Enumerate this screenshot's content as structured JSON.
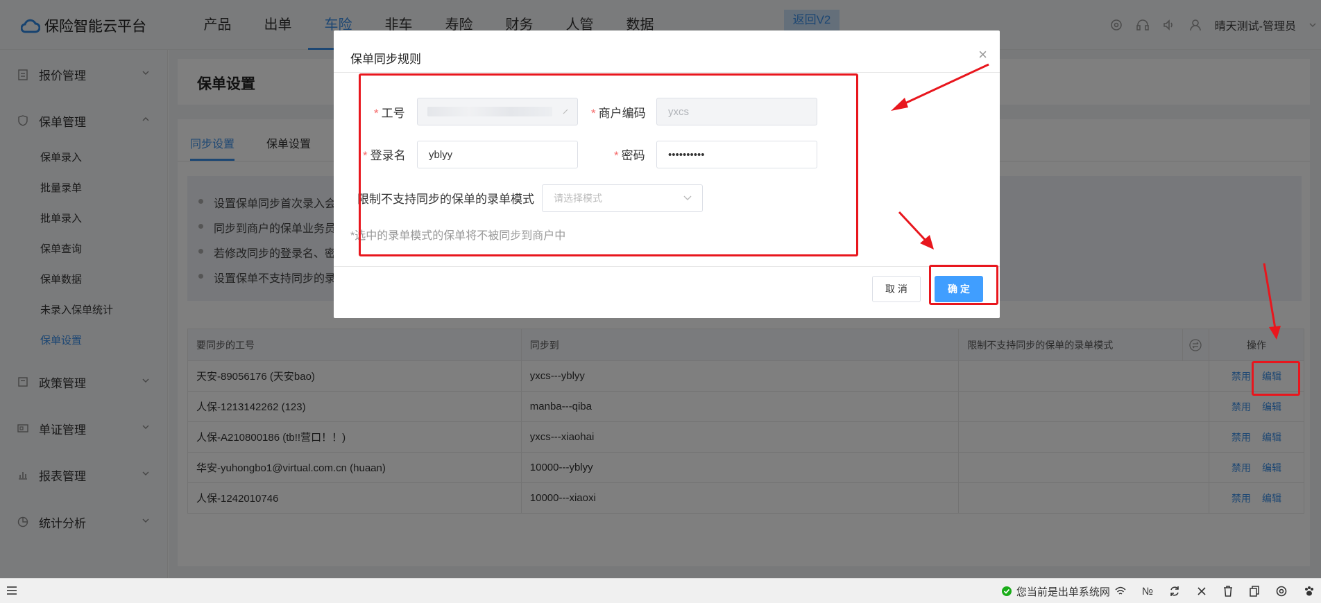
{
  "app": {
    "title": "保险智能云平台"
  },
  "topnav": {
    "items": [
      "产品",
      "出单",
      "车险",
      "非车",
      "寿险",
      "财务",
      "人管",
      "数据"
    ],
    "active_index": 2,
    "back_v2": "返回V2",
    "user": "晴天测试-管理员"
  },
  "sidebar": {
    "groups": {
      "quote": "报价管理",
      "policy": "保单管理",
      "rule": "政策管理",
      "voucher": "单证管理",
      "report": "报表管理",
      "stats": "统计分析"
    },
    "policy_items": [
      "保单录入",
      "批量录单",
      "批单录入",
      "保单查询",
      "保单数据",
      "未录入保单统计",
      "保单设置"
    ],
    "active_item": "保单设置"
  },
  "page": {
    "title": "保单设置",
    "tabs": [
      "同步设置",
      "保单设置"
    ],
    "tips": [
      "设置保单同步首次录入会",
      "同步到商户的保单业务员",
      "若修改同步的登录名、密",
      "设置保单不支持同步的录"
    ]
  },
  "table": {
    "headers": [
      "要同步的工号",
      "同步到",
      "限制不支持同步的保单的录单模式",
      "",
      "操作"
    ],
    "rows": [
      {
        "account": "天安-89056176 (天安bao)",
        "target": "yxcs---yblyy",
        "mode": ""
      },
      {
        "account": "人保-1213142262 (123)",
        "target": "manba---qiba",
        "mode": ""
      },
      {
        "account": "人保-A210800186 (tb!!营口！！)",
        "target": "yxcs---xiaohai",
        "mode": ""
      },
      {
        "account": "华安-yuhongbo1@virtual.com.cn (huaan)",
        "target": "10000---yblyy",
        "mode": ""
      },
      {
        "account": "人保-1242010746",
        "target": "10000---xiaoxi",
        "mode": ""
      }
    ],
    "op_disable": "禁用",
    "op_edit": "编辑"
  },
  "dialog": {
    "title": "保单同步规则",
    "close": "×",
    "fields": {
      "account_label": "工号",
      "merchant_label": "商户编码",
      "merchant_value": "yxcs",
      "login_label": "登录名",
      "login_value": "yblyy",
      "password_label": "密码",
      "password_value": "••••••••••",
      "mode_label": "限制不支持同步的保单的录单模式",
      "mode_placeholder": "请选择模式"
    },
    "required_mark": "*",
    "hint": "*选中的录单模式的保单将不被同步到商户中",
    "cancel": "取 消",
    "ok": "确 定"
  },
  "statusbar": {
    "status": "您当前是出单系统网",
    "no": "№"
  },
  "colors": {
    "accent": "#3a8ee6",
    "primary_button": "#409eff",
    "annotation": "#e8161d",
    "required": "#f56c6c"
  }
}
